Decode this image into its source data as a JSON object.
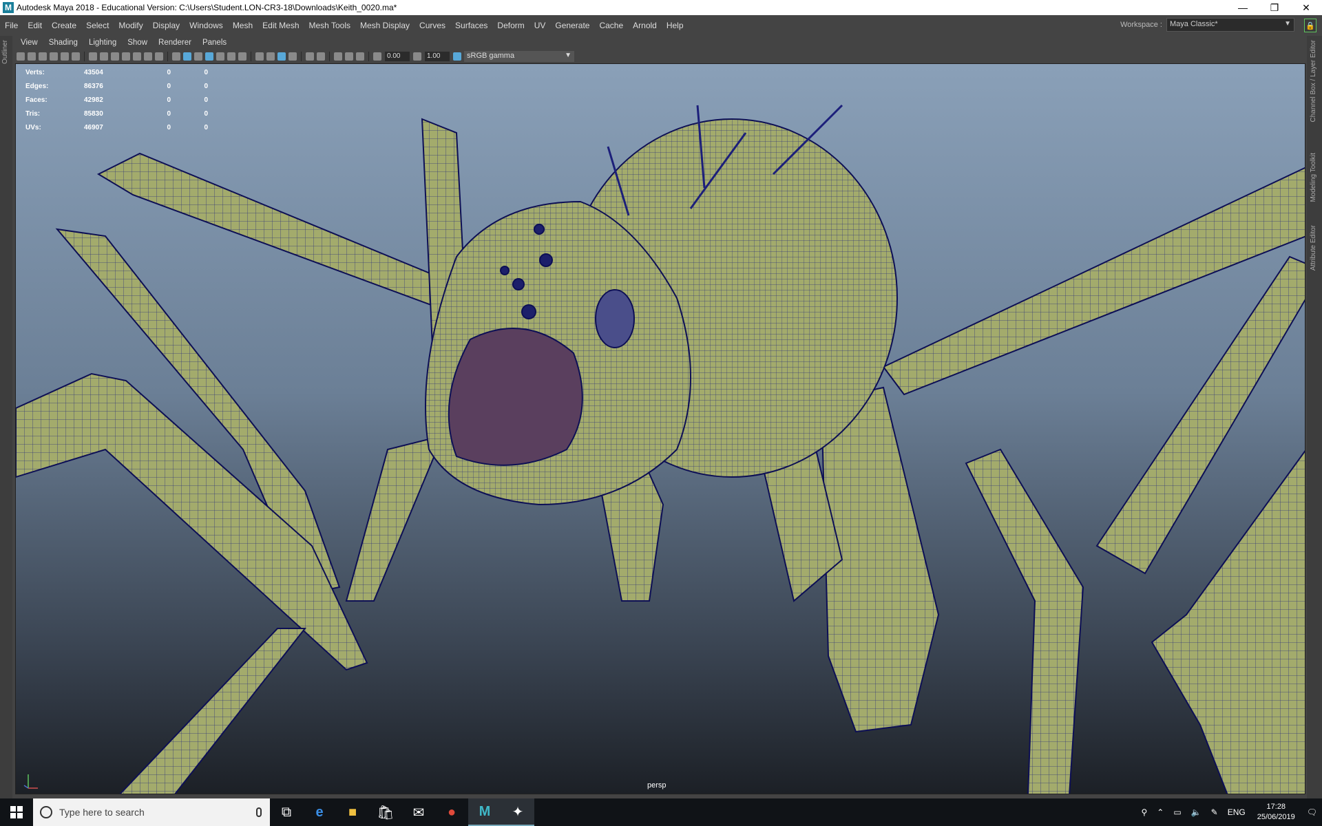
{
  "window": {
    "title": "Autodesk Maya 2018 - Educational Version: C:\\Users\\Student.LON-CR3-18\\Downloads\\Keith_0020.ma*",
    "app_icon": "M"
  },
  "menu": [
    "File",
    "Edit",
    "Create",
    "Select",
    "Modify",
    "Display",
    "Windows",
    "Mesh",
    "Edit Mesh",
    "Mesh Tools",
    "Mesh Display",
    "Curves",
    "Surfaces",
    "Deform",
    "UV",
    "Generate",
    "Cache",
    "Arnold",
    "Help"
  ],
  "workspace": {
    "label": "Workspace :",
    "value": "Maya Classic*"
  },
  "left_tabs": {
    "outliner": "Outliner"
  },
  "right_tabs": {
    "channel_box": "Channel Box / Layer Editor",
    "modeling_toolkit": "Modeling Toolkit",
    "attribute_editor": "Attribute Editor"
  },
  "panel_menu": [
    "View",
    "Shading",
    "Lighting",
    "Show",
    "Renderer",
    "Panels"
  ],
  "panel_toolbar": {
    "exposure": "0.00",
    "gamma": "1.00",
    "color_space": "sRGB gamma"
  },
  "hud": [
    {
      "label": "Verts:",
      "v1": "43504",
      "v2": "0",
      "v3": "0"
    },
    {
      "label": "Edges:",
      "v1": "86376",
      "v2": "0",
      "v3": "0"
    },
    {
      "label": "Faces:",
      "v1": "42982",
      "v2": "0",
      "v3": "0"
    },
    {
      "label": "Tris:",
      "v1": "85830",
      "v2": "0",
      "v3": "0"
    },
    {
      "label": "UVs:",
      "v1": "46907",
      "v2": "0",
      "v3": "0"
    }
  ],
  "camera": "persp",
  "taskbar": {
    "search_placeholder": "Type here to search",
    "lang": "ENG",
    "time": "17:28",
    "date": "25/06/2019"
  },
  "colors": {
    "mesh": "#a3ab6c",
    "wire": "#1c1f7a",
    "mouth": "#5a3f5e",
    "accent": "#5fc45f"
  }
}
